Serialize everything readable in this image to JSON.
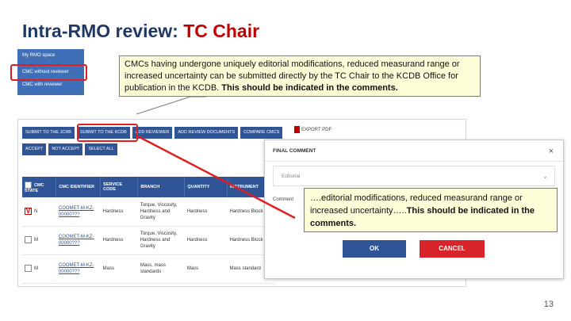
{
  "slide": {
    "title_prefix": "Intra-RMO review: ",
    "title_accent": "TC Chair",
    "page_number": "13",
    "colors": {
      "title": "#1f3864",
      "accent": "#c00000",
      "app_blue": "#2f5597",
      "highlight": "#e02020",
      "callout_bg": "#fdfdd8"
    }
  },
  "menu": {
    "items": [
      "My RMO space",
      "CMC without reviewer",
      "CMC with reviewer"
    ]
  },
  "callout_top": {
    "text": "CMCs having undergone uniquely editorial modifications, reduced measurand range or increased uncertainty can be submitted directly by the TC Chair to the KCDB Office for publication in the KCDB. ",
    "bold": "This should be indicated in the comments."
  },
  "toolbar": {
    "row1": [
      "SUBMIT TO THE JCRB",
      "SUBMIT TO THE KCDB",
      "ADD REVIEWER",
      "ADD REVIEW DOCUMENTS",
      "COMPARE CMCS"
    ],
    "row2": [
      "ACCEPT",
      "NOT ACCEPT",
      "SELECT ALL"
    ],
    "export": "EXPORT PDF"
  },
  "table": {
    "headers": [
      "CMC STATE",
      "CMC IDENTIFIER",
      "SERVICE CODE",
      "BRANCH",
      "QUANTITY",
      "INSTRUMENT"
    ],
    "rows": [
      {
        "state": "N",
        "checked": "V",
        "id": "COOMET-M-KZ-00000???",
        "service": "Hardness",
        "branch": "Torque, Viscosity, Hardness and Gravity",
        "quantity": "Hardness",
        "instrument": "Hardness Block"
      },
      {
        "state": "M",
        "checked": "",
        "id": "COOMET-M-KZ-00000???",
        "service": "Hardness",
        "branch": "Torque, Viscosity, Hardness and Gravity",
        "quantity": "Hardness",
        "instrument": "Hardness Block"
      },
      {
        "state": "M",
        "checked": "",
        "id": "COOMET-M-KZ-00000???",
        "service": "Mass",
        "branch": "Mass, mass standards",
        "quantity": "Mass",
        "instrument": "Mass standard"
      }
    ]
  },
  "modal": {
    "title": "FINAL COMMENT",
    "close_icon": "×",
    "select_value": "Editorial",
    "comment_label": "Comment",
    "ok": "OK",
    "cancel": "CANCEL"
  },
  "callout_low": {
    "text": "….editorial modifications, reduced measurand range or increased uncertainty…..",
    "bold": "This should be indicated in the comments."
  }
}
